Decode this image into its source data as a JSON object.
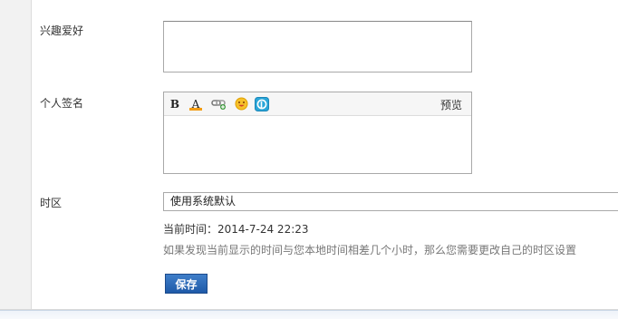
{
  "fields": {
    "hobby_label": "兴趣爱好",
    "hobby_value": "",
    "signature_label": "个人签名",
    "signature_value": "",
    "timezone_label": "时区"
  },
  "editor": {
    "toolbar": {
      "bold_icon": "bold-icon",
      "font_color_icon": "font-color-icon",
      "bold_glyph": "B",
      "font_color_glyph": "A",
      "link_icon": "link-icon",
      "emoticon_icon": "emoticon-icon",
      "p_icon": "p-badge-icon",
      "preview_label": "预览"
    },
    "accent_color": "#f39c12"
  },
  "timezone": {
    "selected": "使用系统默认",
    "current_time_label": "当前时间：",
    "current_time_value": "2014-7-24 22:23",
    "hint": "如果发现当前显示的时间与您本地时间相差几个小时，那么您需要更改自己的时区设置"
  },
  "actions": {
    "save_label": "保存",
    "save_color": "#1e5aa8"
  }
}
